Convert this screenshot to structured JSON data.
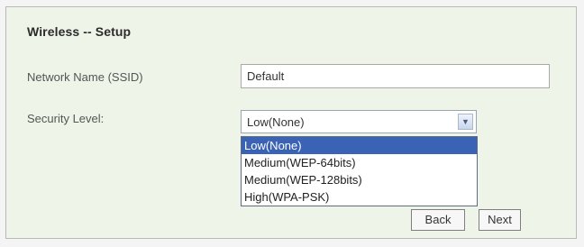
{
  "form": {
    "title": "Wireless -- Setup",
    "ssid_label": "Network Name (SSID)",
    "ssid_value": "Default",
    "security_label": "Security Level:",
    "security_selected": "Low(None)",
    "security_options": [
      "Low(None)",
      "Medium(WEP-64bits)",
      "Medium(WEP-128bits)",
      "High(WPA-PSK)"
    ],
    "highlighted_option_index": 0,
    "arrow_icon": "chevron-down-icon"
  },
  "buttons": {
    "back_label": "Back",
    "next_label": "Next"
  }
}
